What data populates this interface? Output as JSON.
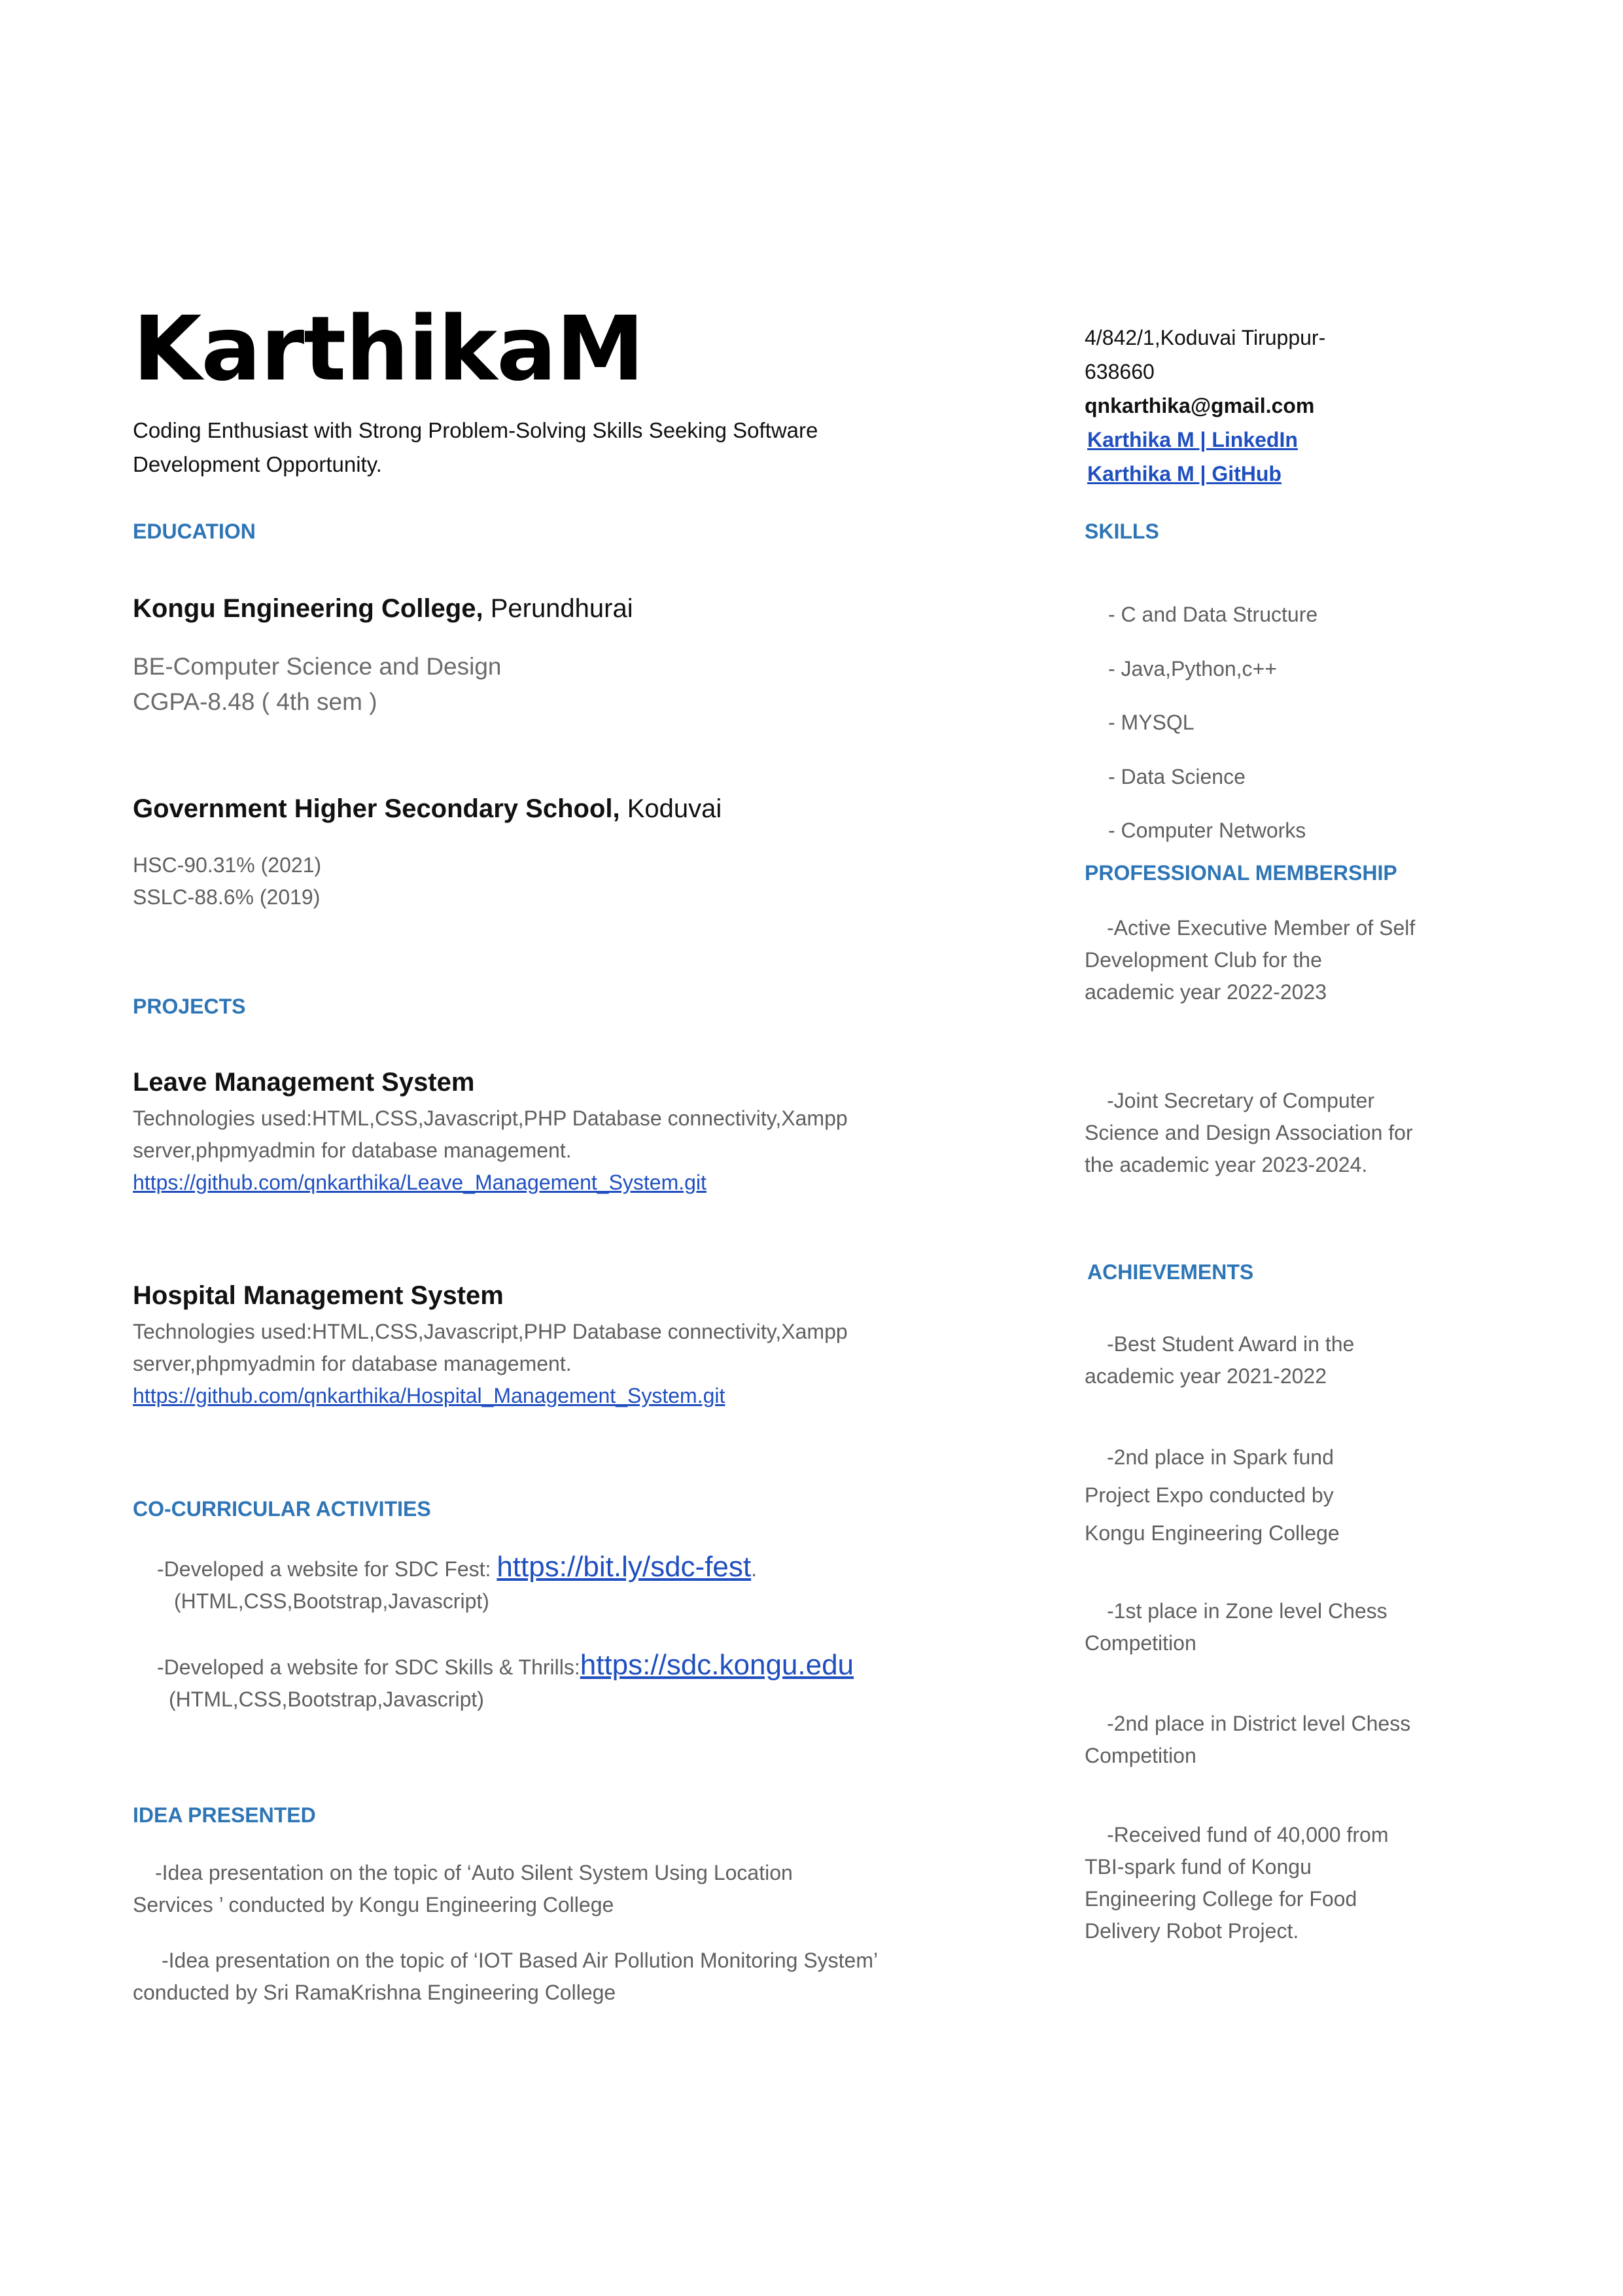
{
  "header": {
    "name": "KarthikaM",
    "tagline_line1": "Coding Enthusiast with Strong Problem-Solving Skills Seeking Software",
    "tagline_line2": "Development Opportunity."
  },
  "contact": {
    "address_line1": "4/842/1,Koduvai Tiruppur-",
    "address_line2": "638660",
    "email": "qnkarthika@gmail.com",
    "linkedin": "Karthika M | LinkedIn",
    "github": "Karthika M | GitHub"
  },
  "education": {
    "heading": "EDUCATION",
    "college": {
      "name": "Kongu Engineering College,",
      "place": " Perundhurai",
      "degree": "BE-Computer Science and Design",
      "cgpa": "CGPA-8.48 ( 4th sem )"
    },
    "school": {
      "name": "Government Higher Secondary School,",
      "place": " Koduvai",
      "hsc": "HSC-90.31% (2021)",
      "sslc": "SSLC-88.6% (2019)"
    }
  },
  "projects": {
    "heading": "PROJECTS",
    "items": [
      {
        "title": "Leave Management System",
        "tech_line1": "Technologies used:HTML,CSS,Javascript,PHP Database connectivity,Xampp",
        "tech_line2": "server,phpmyadmin for database management.",
        "link": "https://github.com/qnkarthika/Leave_Management_System.git"
      },
      {
        "title": "Hospital Management System",
        "tech_line1": "Technologies used:HTML,CSS,Javascript,PHP Database connectivity,Xampp",
        "tech_line2": "server,phpmyadmin for database management.",
        "link": "https://github.com/qnkarthika/Hospital_Management_System.git"
      }
    ]
  },
  "cocurricular": {
    "heading": "CO-CURRICULAR ACTIVITIES",
    "items": [
      {
        "text": "-Developed a website for SDC Fest: ",
        "link": "https://bit.ly/sdc-fest",
        "after": ".",
        "stack": "(HTML,CSS,Bootstrap,Javascript)"
      },
      {
        "text": "-Developed a website for SDC Skills & Thrills:",
        "link": "https://sdc.kongu.edu",
        "after": "",
        "stack": "(HTML,CSS,Bootstrap,Javascript)"
      }
    ]
  },
  "ideas": {
    "heading": "IDEA PRESENTED",
    "items": [
      {
        "line1": "-Idea presentation on the topic of ‘Auto Silent System Using Location",
        "line2": "Services ’ conducted by Kongu Engineering College"
      },
      {
        "line1": "-Idea presentation on the topic of ‘IOT Based Air Pollution Monitoring System’",
        "line2": "conducted by Sri RamaKrishna Engineering College"
      }
    ]
  },
  "skills": {
    "heading": "SKILLS",
    "items": [
      "-  C and Data Structure",
      "-  Java,Python,c++",
      "- MYSQL",
      "- Data Science",
      "- Computer Networks"
    ]
  },
  "membership": {
    "heading": "PROFESSIONAL MEMBERSHIP",
    "items": [
      [
        "-Active Executive Member of Self",
        "Development Club for the",
        "academic year 2022-2023"
      ],
      [
        "-Joint Secretary of Computer",
        "Science and Design Association for",
        "the academic year 2023-2024."
      ]
    ]
  },
  "achievements": {
    "heading": "ACHIEVEMENTS",
    "items": [
      [
        "-Best Student Award in the",
        "academic year 2021-2022"
      ],
      [
        "-2nd place in Spark fund",
        "Project Expo conducted by",
        "Kongu Engineering College"
      ],
      [
        "-1st place in Zone level Chess",
        "Competition"
      ],
      [
        "-2nd place in District level Chess",
        "Competition"
      ],
      [
        "-Received fund of 40,000 from",
        "TBI-spark fund of Kongu",
        "Engineering College for Food",
        "Delivery Robot Project."
      ]
    ]
  }
}
